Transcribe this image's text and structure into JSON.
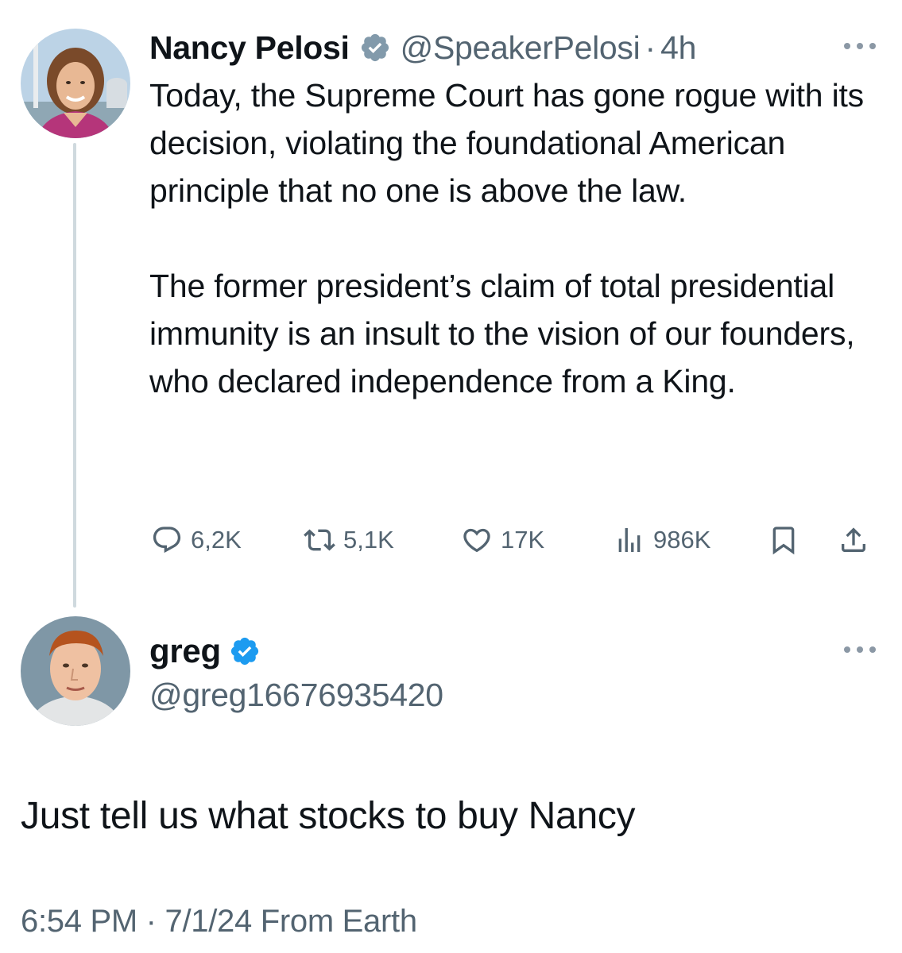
{
  "original_tweet": {
    "author_name": "Nancy Pelosi",
    "verified_badge": "gray-verified-badge-icon",
    "handle": "@SpeakerPelosi",
    "separator": "·",
    "time_ago": "4h",
    "text": "Today, the Supreme Court has gone rogue with its decision, violating the foundational American principle that no one is above the law.\n\nThe former president’s claim of total presidential immunity is an insult to the vision of our founders, who declared independence from a King.",
    "metrics": {
      "replies": "6,2K",
      "reposts": "5,1K",
      "likes": "17K",
      "views": "986K"
    }
  },
  "reply_tweet": {
    "author_name": "greg",
    "verified_badge": "blue-verified-badge-icon",
    "handle": "@greg16676935420",
    "text": "Just tell us what stocks to buy Nancy",
    "timestamp": "6:54 PM · 7/1/24 From Earth"
  },
  "colors": {
    "text_primary": "#0f1419",
    "text_secondary": "#536471",
    "thread_line": "#cfd9de",
    "verified_blue": "#1d9bf0",
    "verified_gray": "#829aab"
  }
}
